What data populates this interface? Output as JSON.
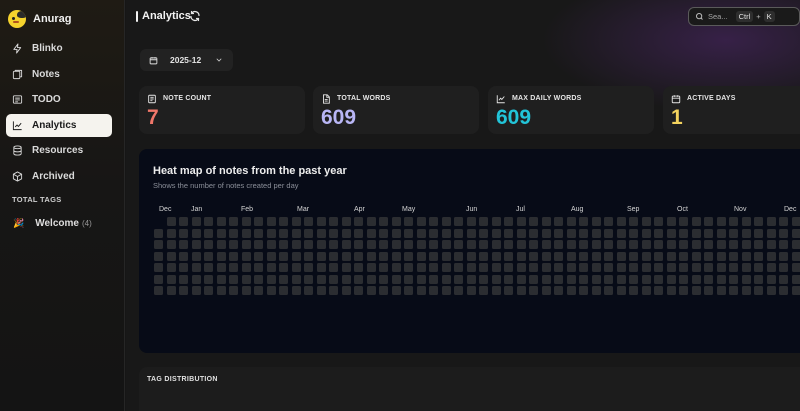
{
  "user": {
    "name": "Anurag"
  },
  "nav": {
    "items": [
      {
        "label": "Blinko",
        "icon": "bolt-icon"
      },
      {
        "label": "Notes",
        "icon": "notes-icon"
      },
      {
        "label": "TODO",
        "icon": "todo-icon"
      },
      {
        "label": "Analytics",
        "icon": "analytics-icon",
        "active": true
      },
      {
        "label": "Resources",
        "icon": "database-icon"
      },
      {
        "label": "Archived",
        "icon": "box-icon"
      }
    ]
  },
  "tags": {
    "title": "TOTAL TAGS",
    "items": [
      {
        "emoji": "🎉",
        "name": "Welcome",
        "count": "(4)"
      }
    ]
  },
  "header": {
    "title": "Analytics"
  },
  "search": {
    "placeholder": "Sea...",
    "key1": "Ctrl",
    "plus": "+",
    "key2": "K"
  },
  "month_select": {
    "value": "2025-12"
  },
  "stats": [
    {
      "label": "NOTE COUNT",
      "value": "7",
      "color": "#f0776a",
      "icon": "note-icon"
    },
    {
      "label": "TOTAL WORDS",
      "value": "609",
      "color": "#b9b6f5",
      "icon": "document-icon"
    },
    {
      "label": "MAX DAILY WORDS",
      "value": "609",
      "color": "#22c4d8",
      "icon": "line-chart-icon"
    },
    {
      "label": "ACTIVE DAYS",
      "value": "1",
      "color": "#f4d35e",
      "icon": "calendar-icon"
    }
  ],
  "heatmap": {
    "title": "Heat map of notes from the past year",
    "subtitle": "Shows the number of notes created per day",
    "months": [
      "Dec",
      "Jan",
      "Feb",
      "Mar",
      "Apr",
      "May",
      "Jun",
      "Jul",
      "Aug",
      "Sep",
      "Oct",
      "Nov",
      "Dec"
    ],
    "empty_color": "#2b2d31"
  },
  "tag_distribution": {
    "label": "TAG DISTRIBUTION"
  }
}
